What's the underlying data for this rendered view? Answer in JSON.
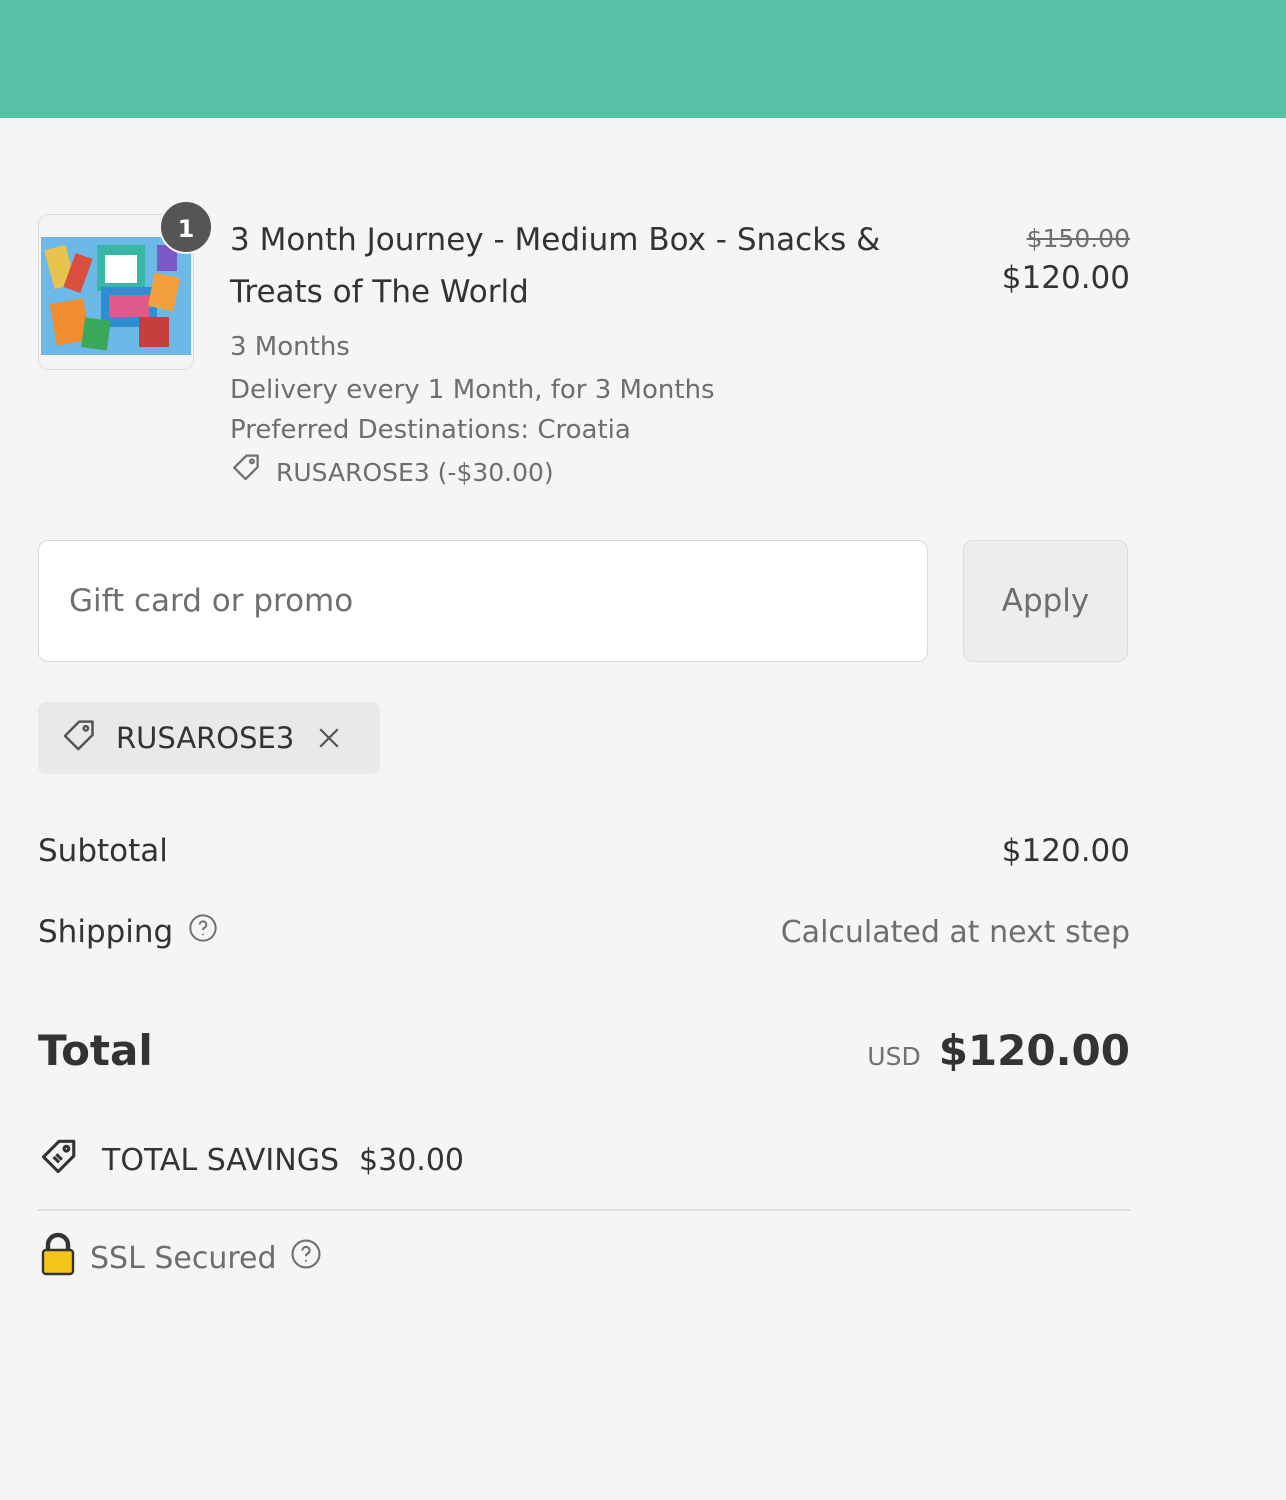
{
  "colors": {
    "header": "#57c1a6",
    "lock": "#f5c518"
  },
  "cart": {
    "item": {
      "quantity": "1",
      "title": "3 Month Journey - Medium Box - Snacks & Treats of The World",
      "plan": "3 Months",
      "delivery": "Delivery every 1 Month, for 3 Months",
      "destinations": "Preferred Destinations: Croatia",
      "discount": "RUSAROSE3 (-$30.00)",
      "original_price": "$150.00",
      "price": "$120.00",
      "image_icon": "snack-box-image"
    }
  },
  "promo": {
    "placeholder": "Gift card or promo",
    "apply_label": "Apply",
    "applied_code": "RUSAROSE3"
  },
  "summary": {
    "subtotal_label": "Subtotal",
    "subtotal_value": "$120.00",
    "shipping_label": "Shipping",
    "shipping_value": "Calculated at next step",
    "total_label": "Total",
    "currency": "USD",
    "total_value": "$120.00",
    "savings_label": "TOTAL SAVINGS",
    "savings_value": "$30.00"
  },
  "security": {
    "label": "SSL Secured"
  }
}
